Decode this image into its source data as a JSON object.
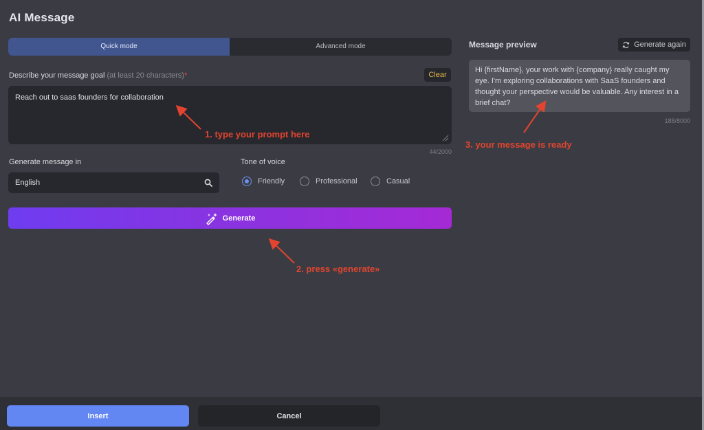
{
  "app": {
    "title": "AI Message"
  },
  "modes": {
    "quick": "Quick mode",
    "advanced": "Advanced mode",
    "selected": "Quick mode"
  },
  "goal": {
    "label": "Describe your message goal",
    "hint": "(at least 20 characters)",
    "required_mark": "*",
    "clear_label": "Clear",
    "value": "Reach out to saas founders for collaboration",
    "counter": "44/2000"
  },
  "language": {
    "label": "Generate message in",
    "value": "English",
    "icon": "search-icon"
  },
  "tone": {
    "label": "Tone of voice",
    "options": [
      "Friendly",
      "Professional",
      "Casual"
    ],
    "selected": "Friendly"
  },
  "generate": {
    "label": "Generate",
    "icon": "magic-wand-icon"
  },
  "preview": {
    "title": "Message preview",
    "regenerate_label": "Generate again",
    "text": "Hi {firstName}, your work with {company} really caught my eye. I'm exploring collaborations with SaaS founders and thought your perspective would be valuable. Any interest in a brief chat?",
    "counter": "188/8000"
  },
  "annotations": {
    "step1": "1. type your prompt here",
    "step2": "2. press «generate»",
    "step3": "3. your message is ready",
    "color": "#e2442f"
  },
  "footer": {
    "insert_label": "Insert",
    "cancel_label": "Cancel"
  },
  "colors": {
    "accent": "#6387f2",
    "gradient_start": "#6f3cf0",
    "gradient_end": "#a52ad6",
    "clear": "#e2b44a"
  }
}
